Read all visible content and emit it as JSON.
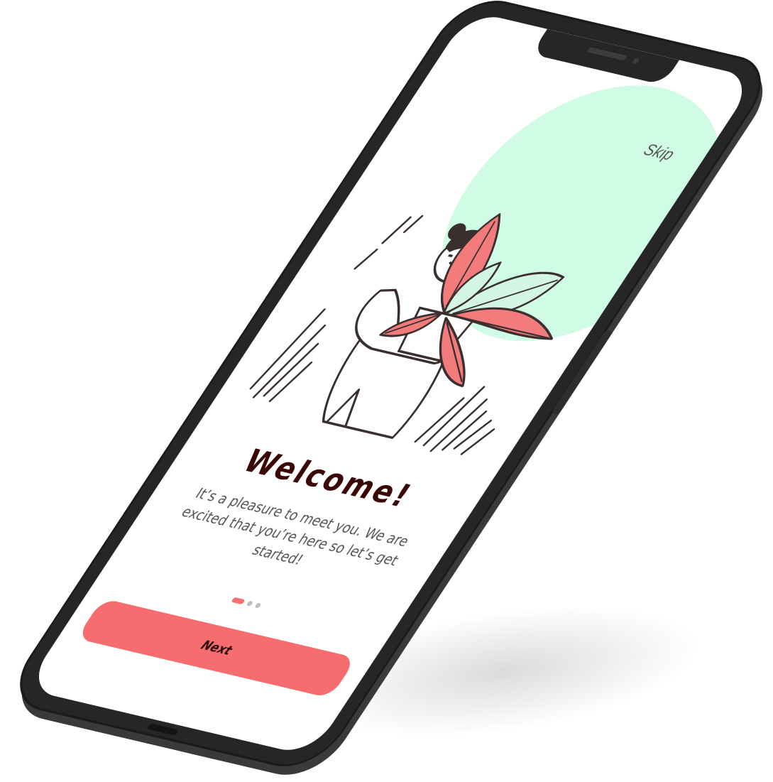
{
  "onboarding": {
    "skip_label": "Skip",
    "title": "Welcome!",
    "subtitle": "It’s a pleasure to meet you. We are excited that you’re here so let’s get started!",
    "pager": {
      "total": 3,
      "current": 1
    },
    "next_label": "Next"
  },
  "illustration": {
    "subject": "person-holding-potted-plant"
  },
  "colors": {
    "accent": "#f76c6f",
    "blob": "#d0fbe5",
    "title": "#3b0606",
    "body_text": "#555555",
    "frame": "#262626",
    "leaf_pink": "#f47b7b",
    "leaf_green": "#d3f5e3",
    "outline": "#3a2f2f"
  }
}
